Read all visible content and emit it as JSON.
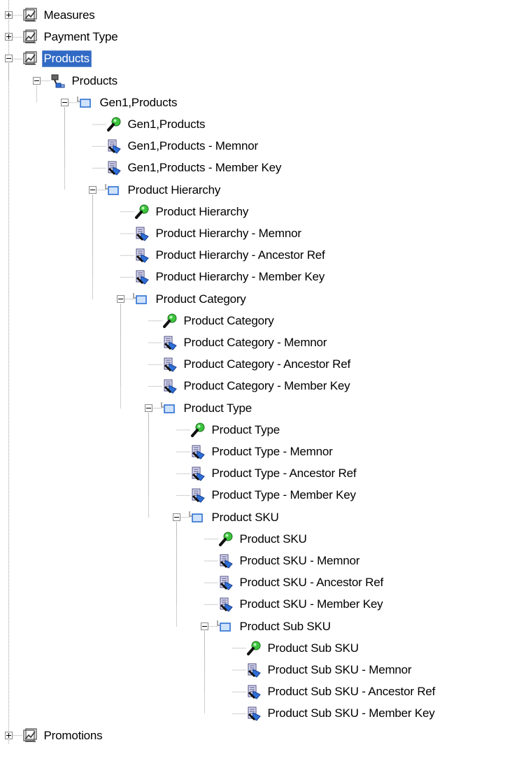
{
  "tree": {
    "items": [
      {
        "label": "Measures",
        "icon": "dimension-icon",
        "level": 0,
        "expander": "collapsed"
      },
      {
        "label": "Payment Type",
        "icon": "dimension-icon",
        "level": 0,
        "expander": "collapsed"
      },
      {
        "label": "Products",
        "icon": "dimension-icon",
        "level": 0,
        "expander": "expanded",
        "selected": true
      },
      {
        "label": "Products",
        "icon": "hierarchy-icon",
        "level": 1,
        "expander": "expanded"
      },
      {
        "label": "Gen1,Products",
        "icon": "level-icon",
        "level": 2,
        "expander": "expanded"
      },
      {
        "label": "Gen1,Products",
        "icon": "key-icon",
        "level": 3
      },
      {
        "label": "Gen1,Products -  Memnor",
        "icon": "attribute-icon",
        "level": 3
      },
      {
        "label": "Gen1,Products - Member Key",
        "icon": "attribute-icon",
        "level": 3
      },
      {
        "label": "Product Hierarchy",
        "icon": "level-icon",
        "level": 3,
        "expander": "expanded"
      },
      {
        "label": "Product Hierarchy",
        "icon": "key-icon",
        "level": 4
      },
      {
        "label": "Product Hierarchy -  Memnor",
        "icon": "attribute-icon",
        "level": 4
      },
      {
        "label": "Product Hierarchy - Ancestor Ref",
        "icon": "attribute-icon",
        "level": 4
      },
      {
        "label": "Product Hierarchy - Member Key",
        "icon": "attribute-icon",
        "level": 4
      },
      {
        "label": "Product Category",
        "icon": "level-icon",
        "level": 4,
        "expander": "expanded"
      },
      {
        "label": "Product Category",
        "icon": "key-icon",
        "level": 5
      },
      {
        "label": "Product Category -  Memnor",
        "icon": "attribute-icon",
        "level": 5
      },
      {
        "label": "Product Category - Ancestor Ref",
        "icon": "attribute-icon",
        "level": 5
      },
      {
        "label": "Product Category - Member Key",
        "icon": "attribute-icon",
        "level": 5
      },
      {
        "label": "Product Type",
        "icon": "level-icon",
        "level": 5,
        "expander": "expanded"
      },
      {
        "label": "Product Type",
        "icon": "key-icon",
        "level": 6
      },
      {
        "label": "Product Type -  Memnor",
        "icon": "attribute-icon",
        "level": 6
      },
      {
        "label": "Product Type - Ancestor Ref",
        "icon": "attribute-icon",
        "level": 6
      },
      {
        "label": "Product Type - Member Key",
        "icon": "attribute-icon",
        "level": 6
      },
      {
        "label": "Product SKU",
        "icon": "level-icon",
        "level": 6,
        "expander": "expanded"
      },
      {
        "label": "Product SKU",
        "icon": "key-icon",
        "level": 7
      },
      {
        "label": "Product SKU -  Memnor",
        "icon": "attribute-icon",
        "level": 7
      },
      {
        "label": "Product SKU - Ancestor Ref",
        "icon": "attribute-icon",
        "level": 7
      },
      {
        "label": "Product SKU - Member Key",
        "icon": "attribute-icon",
        "level": 7
      },
      {
        "label": "Product Sub SKU",
        "icon": "level-icon",
        "level": 7,
        "expander": "expanded"
      },
      {
        "label": "Product Sub SKU",
        "icon": "key-icon",
        "level": 8
      },
      {
        "label": "Product Sub SKU -  Memnor",
        "icon": "attribute-icon",
        "level": 8
      },
      {
        "label": "Product Sub SKU - Ancestor Ref",
        "icon": "attribute-icon",
        "level": 8
      },
      {
        "label": "Product Sub SKU - Member Key",
        "icon": "attribute-icon",
        "level": 8
      },
      {
        "label": "Promotions",
        "icon": "dimension-icon",
        "level": 0,
        "expander": "collapsed"
      }
    ]
  },
  "colors": {
    "selection": "#316ac5",
    "tree_line": "#a0a0a0",
    "key_green": "#3cc43c",
    "cube_blue": "#2f6fd6"
  }
}
